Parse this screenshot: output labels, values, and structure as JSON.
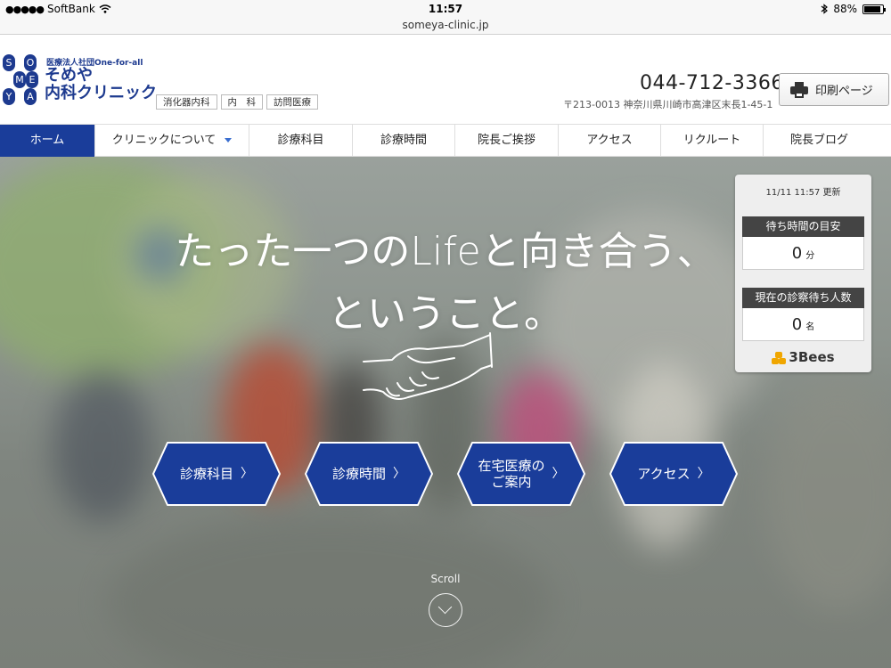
{
  "status_bar": {
    "carrier": "SoftBank",
    "time": "11:57",
    "battery": "88%",
    "battery_level": 0.88
  },
  "url_bar": {
    "url": "someya-clinic.jp"
  },
  "header": {
    "logo_cells": [
      "SO",
      "ME",
      "YA"
    ],
    "logo_corp": "医療法人社団One-for-all",
    "logo_name_1": "そめや",
    "logo_name_2": "内科クリニック",
    "departments": [
      "消化器内科",
      "内　科",
      "訪問医療"
    ],
    "phone": "044-712-3366",
    "address": "〒213-0013 神奈川県川崎市高津区末長1-45-1",
    "print_label": "印刷ページ"
  },
  "nav": {
    "items": [
      {
        "label": "ホーム",
        "active": true
      },
      {
        "label": "クリニックについて",
        "active": false,
        "dropdown": true
      },
      {
        "label": "診療科目",
        "active": false
      },
      {
        "label": "診療時間",
        "active": false
      },
      {
        "label": "院長ご挨拶",
        "active": false
      },
      {
        "label": "アクセス",
        "active": false
      },
      {
        "label": "リクルート",
        "active": false
      },
      {
        "label": "院長ブログ",
        "active": false
      }
    ]
  },
  "hero": {
    "line1": "たった一つのLifeと向き合う、",
    "line2": "ということ。",
    "buttons": [
      {
        "label": "診療科目"
      },
      {
        "label": "診療時間"
      },
      {
        "label_1": "在宅医療の",
        "label_2": "ご案内"
      },
      {
        "label": "アクセス"
      }
    ],
    "chevron": "〉",
    "scroll_label": "Scroll"
  },
  "widget": {
    "updated": "11/11 11:57 更新",
    "wait_time_label": "待ち時間の目安",
    "wait_time_value": "0",
    "wait_time_unit": "分",
    "waiting_people_label": "現在の診察待ち人数",
    "waiting_people_value": "0",
    "waiting_people_unit": "名",
    "brand": "3Bees"
  },
  "colors": {
    "brand_blue": "#1a3d9a",
    "nav_active": "#1a3d9a"
  }
}
